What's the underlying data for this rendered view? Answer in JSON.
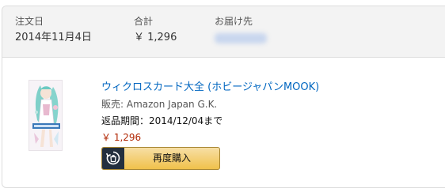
{
  "order_header": {
    "date_label": "注文日",
    "date_value": "2014年11月4日",
    "total_label": "合計",
    "total_value": "￥ 1,296",
    "ship_to_label": "お届け先"
  },
  "item": {
    "title": "ウィクロスカード大全 (ホビージャパンMOOK)",
    "seller": "販売: Amazon Japan G.K.",
    "return_period": "返品期間：2014/12/04まで",
    "price": "￥ 1,296",
    "rebuy_label": "再度購入"
  },
  "colors": {
    "link": "#0066c0",
    "price": "#b12704",
    "button": "#f0c14b",
    "button_icon_bg": "#232f3e"
  }
}
